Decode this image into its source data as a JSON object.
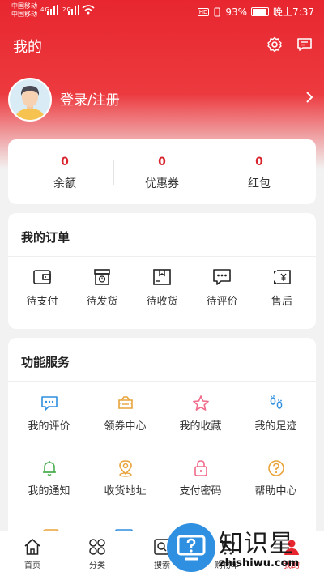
{
  "status_bar": {
    "carrier1": "中国移动",
    "carrier2": "中国移动",
    "sig1": "4G",
    "sig2": "2G",
    "hd": "HD",
    "battery": "93%",
    "time": "晚上7:37"
  },
  "header": {
    "title": "我的"
  },
  "profile": {
    "login_label": "登录/注册"
  },
  "assets": [
    {
      "value": "0",
      "label": "余额"
    },
    {
      "value": "0",
      "label": "优惠券"
    },
    {
      "value": "0",
      "label": "红包"
    }
  ],
  "orders": {
    "title": "我的订单",
    "items": [
      {
        "label": "待支付",
        "icon": "wallet-icon"
      },
      {
        "label": "待发货",
        "icon": "box-clock-icon"
      },
      {
        "label": "待收货",
        "icon": "package-icon"
      },
      {
        "label": "待评价",
        "icon": "comment-icon"
      },
      {
        "label": "售后",
        "icon": "yen-return-icon"
      }
    ]
  },
  "services": {
    "title": "功能服务",
    "items": [
      {
        "label": "我的评价",
        "icon": "comment-icon"
      },
      {
        "label": "领券中心",
        "icon": "coupon-icon"
      },
      {
        "label": "我的收藏",
        "icon": "star-icon"
      },
      {
        "label": "我的足迹",
        "icon": "footprint-icon"
      },
      {
        "label": "我的通知",
        "icon": "bell-icon"
      },
      {
        "label": "收货地址",
        "icon": "location-icon"
      },
      {
        "label": "支付密码",
        "icon": "lock-icon"
      },
      {
        "label": "帮助中心",
        "icon": "help-icon"
      }
    ]
  },
  "tabbar": [
    {
      "label": "首页",
      "icon": "home-icon"
    },
    {
      "label": "分类",
      "icon": "category-icon"
    },
    {
      "label": "搜索",
      "icon": "search-icon"
    },
    {
      "label": "购物车",
      "icon": "cart-icon"
    },
    {
      "label": "我的",
      "icon": "user-icon"
    }
  ],
  "watermark": {
    "text": "知识星",
    "url": "zhishiwu.com"
  },
  "colors": {
    "brand_red": "#e8262f",
    "accent_blue": "#2f8fe0",
    "accent_green": "#4caf50",
    "accent_orange": "#e8a33b",
    "accent_pink": "#f06b8a"
  }
}
